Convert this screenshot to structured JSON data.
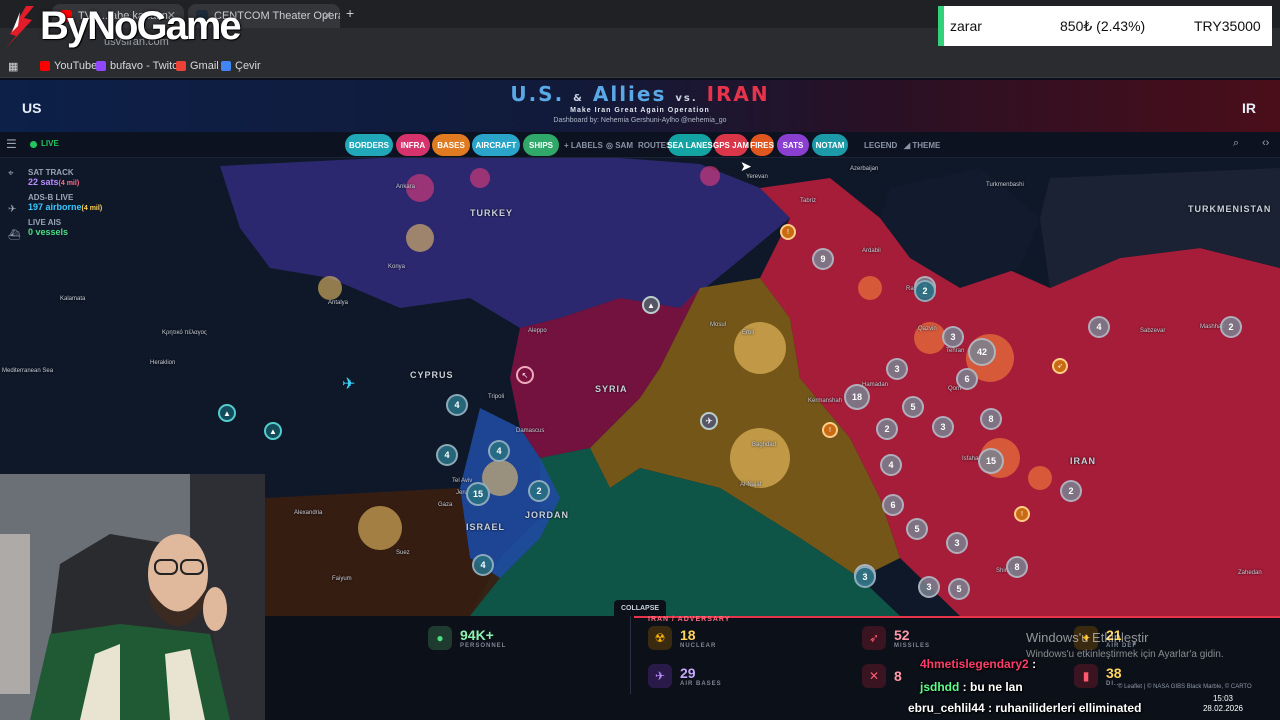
{
  "browser": {
    "tabs": [
      {
        "title": "TV - ...abe kanalın..."
      },
      {
        "title": "CENTCOM Theater Operations"
      }
    ],
    "url": "usvsiran.com",
    "new_tab": "+",
    "bookmarks": [
      {
        "label": "YouTube",
        "color": "#ff0000"
      },
      {
        "label": "bufavo - Twitch",
        "color": "#9146ff"
      },
      {
        "label": "Gmail",
        "color": "#ea4335"
      },
      {
        "label": "Çevir",
        "color": "#4285f4"
      }
    ]
  },
  "overlay": {
    "logo_text": "ByNoGame"
  },
  "ticker": {
    "name": "zarar",
    "change": "850₺ (2.43%)",
    "total": "TRY35000",
    "accent": "#33d17a"
  },
  "dashboard": {
    "left_side": "US",
    "right_side": "IR",
    "title_us": "U.S.",
    "title_amp": "&",
    "title_allies": "Allies",
    "title_vs": "vs.",
    "title_iran": "IRAN",
    "subtitle": "Make Iran Great Again Operation",
    "credit": "Dashboard by: Nehemia Gershuni-Aylho @nehemia_go",
    "live_label": "LIVE",
    "colors": {
      "us": "#5aa9e6",
      "iran": "#e8344a",
      "live": "#22c55e"
    }
  },
  "toolbar": {
    "pills": [
      {
        "label": "BORDERS",
        "color": "#20a7b8"
      },
      {
        "label": "INFRA",
        "color": "#d6336c"
      },
      {
        "label": "BASES",
        "color": "#e07b21"
      },
      {
        "label": "AIRCRAFT",
        "color": "#2aa4c9"
      },
      {
        "label": "SHIPS",
        "color": "#2fa86a"
      },
      {
        "label": "SEA LANES",
        "color": "#14a3a3"
      },
      {
        "label": "GPS JAM",
        "color": "#d9364a"
      },
      {
        "label": "FIRES",
        "color": "#e0561f"
      },
      {
        "label": "SATS",
        "color": "#8a3fd0"
      },
      {
        "label": "NOTAM",
        "color": "#1d9aa8"
      }
    ],
    "plain": [
      "+ LABELS",
      "◎ SAM",
      "ROUTES",
      "LEGEND",
      "◢ THEME"
    ]
  },
  "left_stats": {
    "sat_title": "SAT TRACK",
    "sat_value": "22 sats",
    "sat_note": "(4 mil)",
    "adsb_title": "ADS-B LIVE",
    "adsb_value": "197 airborne",
    "adsb_note": "(4 mil)",
    "ais_title": "LIVE AIS",
    "ais_value": "0 vessels"
  },
  "map_labels": {
    "countries": [
      "TURKEY",
      "SYRIA",
      "IRAN",
      "JORDAN",
      "TURKMENISTAN",
      "ISRAEL",
      "CYPRUS"
    ],
    "cities": [
      "Ankara",
      "Konya",
      "Antalya",
      "Kalamata",
      "Κρητικό πέλαγος",
      "Mediterranean Sea",
      "Heraklion",
      "Aleppo",
      "Tripoli",
      "Damascus",
      "Tel Aviv",
      "Jerusalem",
      "Gaza",
      "Alexandria",
      "Suez",
      "Mosul",
      "Erbil",
      "Baghdad",
      "Al-Najaf",
      "Hamadan",
      "Kermanshah",
      "Tehran",
      "Qazvin",
      "Rasht",
      "Qom",
      "Isfahan",
      "Shiraz",
      "Mashhad",
      "Sabzevar",
      "Yerevan",
      "Tabriz",
      "Ardabil",
      "Azerbaijan",
      "Zahedan",
      "Turkmenbashi",
      "Faiyum"
    ],
    "clusters": [
      "9",
      "2",
      "4",
      "2",
      "3",
      "42",
      "3",
      "6",
      "18",
      "5",
      "3",
      "8",
      "2",
      "4",
      "15",
      "2",
      "6",
      "5",
      "3",
      "8",
      "3",
      "3",
      "5",
      "4",
      "4",
      "4",
      "15",
      "2",
      "4",
      "3",
      "2"
    ]
  },
  "bottom": {
    "collapse": "COLLAPSE",
    "personnel_value": "94K+",
    "personnel_label": "PERSONNEL",
    "iran_header": "IRAN / ADVERSARY",
    "nuclear_value": "18",
    "nuclear_label": "NUCLEAR",
    "missiles_value": "52",
    "missiles_label": "MISSILES",
    "airbases_value": "29",
    "airbases_label": "AIR BASES",
    "air_def_value": "21",
    "air_def_label": "AIR DEF",
    "drones_value": "38",
    "drones_label": "DI...",
    "row2_value": "8",
    "attribution": "© Leaflet | © NASA GIBS Black Marble, © CARTO"
  },
  "chat": [
    {
      "user": "4hmetislegendary2",
      "text": ":",
      "color": "#ff3b6b"
    },
    {
      "user": "jsdhdd",
      "text": ": bu ne lan",
      "color": "#5cff8a"
    },
    {
      "user": "ebru_cehlil44",
      "text": ": ruhaniliderleri elliminated",
      "color": "#ffffff"
    }
  ],
  "windows": {
    "activation_title": "Windows'u Etkinleştir",
    "activation_sub": "Windows'u etkinleştirmek için Ayarlar'a gidin.",
    "time": "15:03",
    "date": "28.02.2026"
  }
}
